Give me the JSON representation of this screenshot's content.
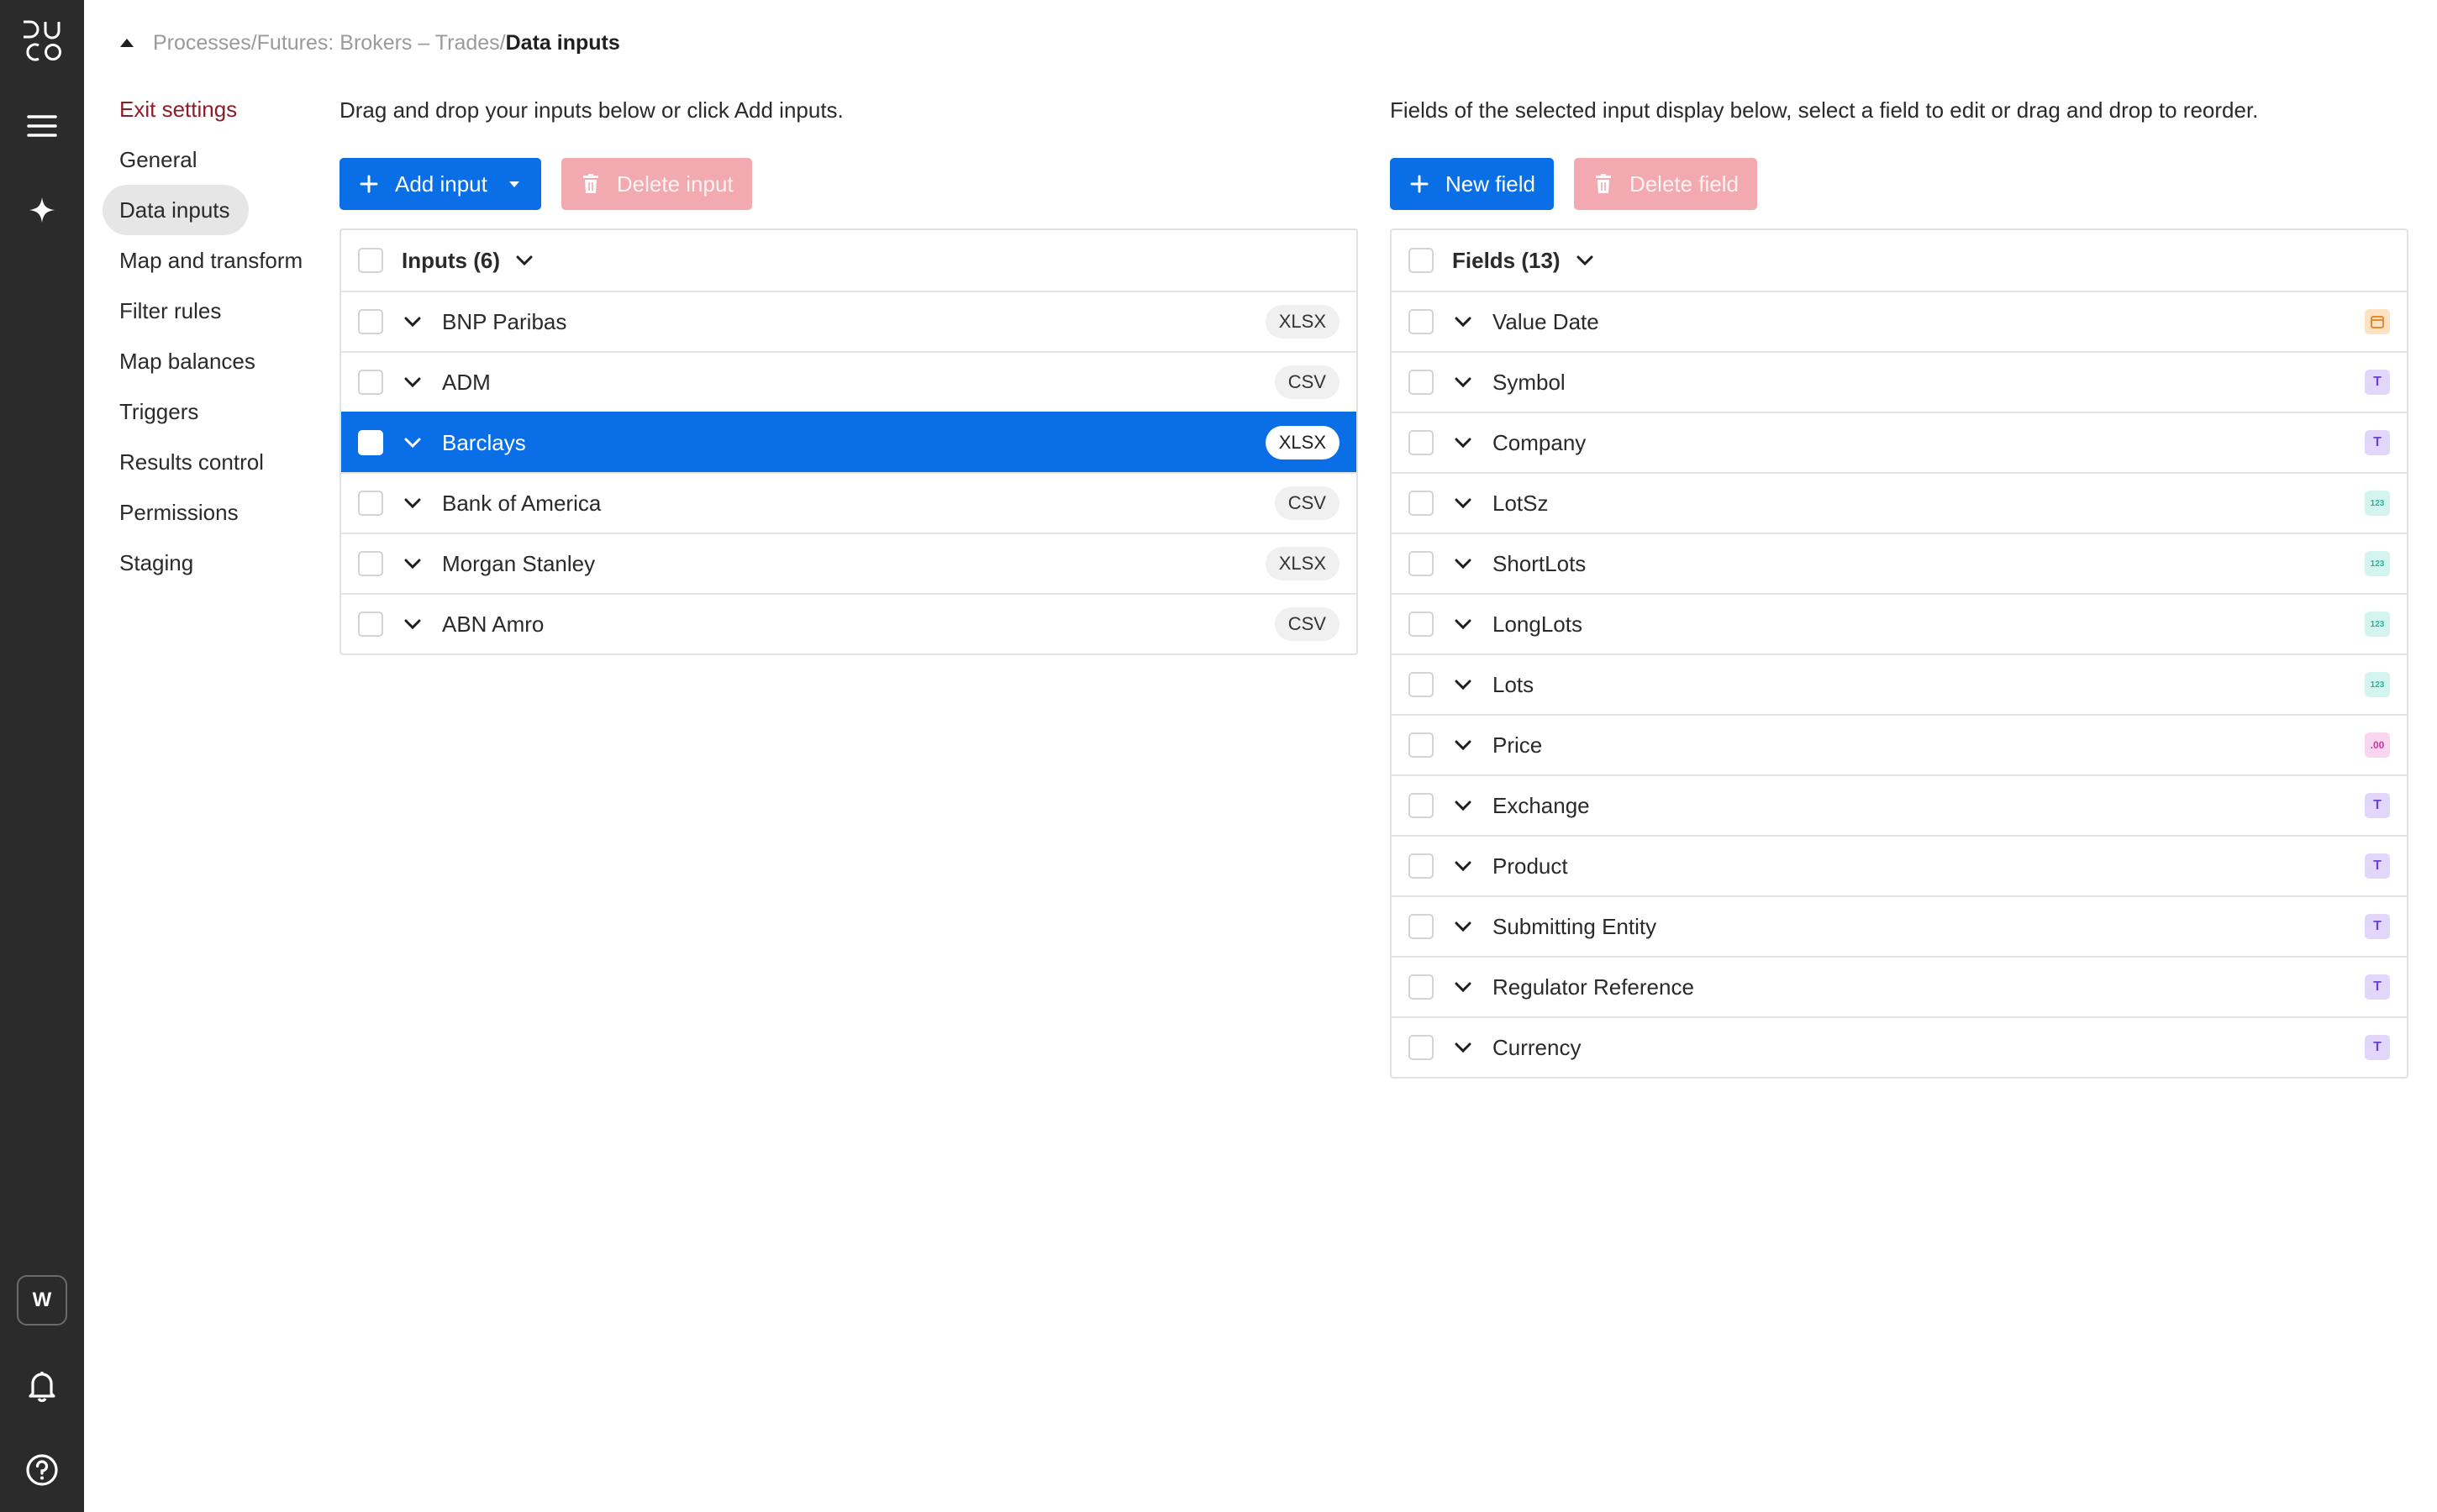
{
  "brand": {
    "logo_text": "DUCO"
  },
  "rail": {
    "icons": [
      "menu-icon",
      "sparkle-icon",
      "bell-icon",
      "help-icon"
    ],
    "workspace_badge": "W"
  },
  "breadcrumb": {
    "path": "Processes/Futures: Brokers – Trades/",
    "current": "Data inputs"
  },
  "nav": {
    "items": [
      {
        "label": "Exit settings"
      },
      {
        "label": "General"
      },
      {
        "label": "Data inputs"
      },
      {
        "label": "Map and transform"
      },
      {
        "label": "Filter rules"
      },
      {
        "label": "Map balances"
      },
      {
        "label": "Triggers"
      },
      {
        "label": "Results control"
      },
      {
        "label": "Permissions"
      },
      {
        "label": "Staging"
      }
    ],
    "active": "Data inputs"
  },
  "inputs_panel": {
    "description": "Drag and drop your inputs below or click Add inputs.",
    "add_label": "Add input",
    "delete_label": "Delete input",
    "header": "Inputs (6)",
    "rows": [
      {
        "name": "BNP Paribas",
        "format": "XLSX"
      },
      {
        "name": "ADM",
        "format": "CSV"
      },
      {
        "name": "Barclays",
        "format": "XLSX"
      },
      {
        "name": "Bank of America",
        "format": "CSV"
      },
      {
        "name": "Morgan Stanley",
        "format": "XLSX"
      },
      {
        "name": "ABN Amro",
        "format": "CSV"
      }
    ],
    "selected": "Barclays"
  },
  "fields_panel": {
    "description": "Fields of the selected input display below, select a field to edit or drag and drop to reorder.",
    "new_label": "New field",
    "delete_label": "Delete field",
    "header": "Fields (13)",
    "rows": [
      {
        "name": "Value Date",
        "type": "date",
        "icon_text": ""
      },
      {
        "name": "Symbol",
        "type": "text",
        "icon_text": "T"
      },
      {
        "name": "Company",
        "type": "text",
        "icon_text": "T"
      },
      {
        "name": "LotSz",
        "type": "number",
        "icon_text": "123"
      },
      {
        "name": "ShortLots",
        "type": "number",
        "icon_text": "123"
      },
      {
        "name": "LongLots",
        "type": "number",
        "icon_text": "123"
      },
      {
        "name": "Lots",
        "type": "number",
        "icon_text": "123"
      },
      {
        "name": "Price",
        "type": "decimal",
        "icon_text": ".00"
      },
      {
        "name": "Exchange",
        "type": "text",
        "icon_text": "T"
      },
      {
        "name": "Product",
        "type": "text",
        "icon_text": "T"
      },
      {
        "name": "Submitting Entity",
        "type": "text",
        "icon_text": "T"
      },
      {
        "name": "Regulator Reference",
        "type": "text",
        "icon_text": "T"
      },
      {
        "name": "Currency",
        "type": "text",
        "icon_text": "T"
      }
    ]
  },
  "colors": {
    "primary": "#0a6ee6",
    "rail": "#2b2b2b",
    "exit_link": "#8b1e2b",
    "disabled_button": "#f2a9b0"
  }
}
